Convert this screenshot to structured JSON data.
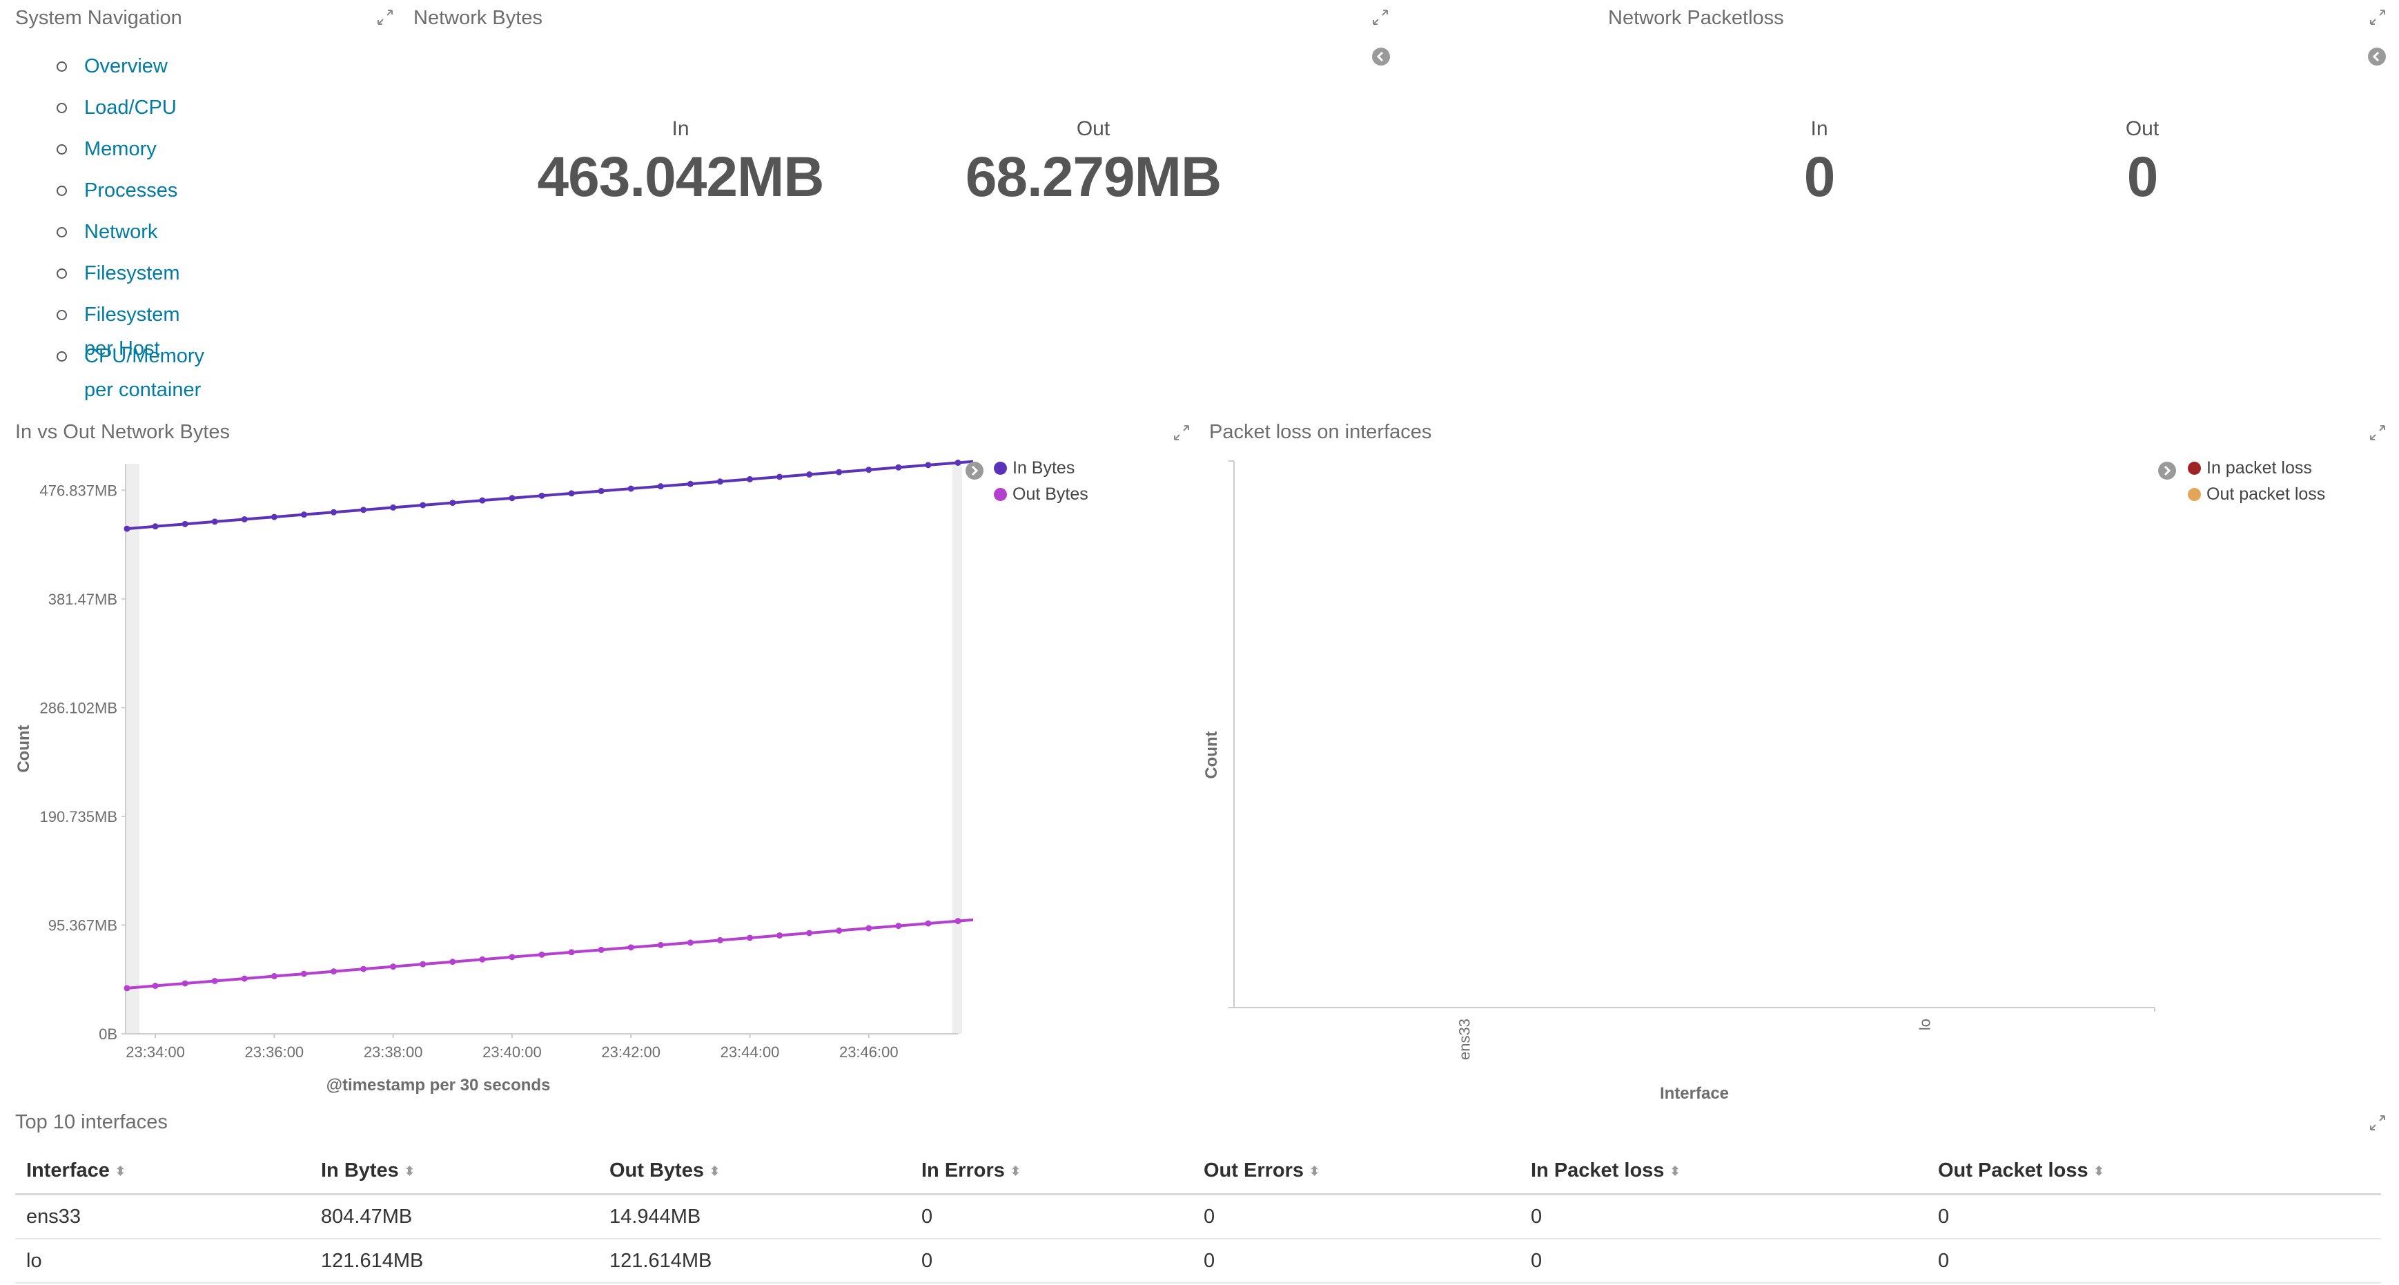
{
  "nav": {
    "title": "System Navigation",
    "items": [
      {
        "label": "Overview"
      },
      {
        "label": "Load/CPU"
      },
      {
        "label": "Memory"
      },
      {
        "label": "Processes"
      },
      {
        "label": "Network"
      },
      {
        "label": "Filesystem"
      },
      {
        "label": "Filesystem per Host"
      },
      {
        "label": "CPU/Memory per container"
      }
    ]
  },
  "network_bytes": {
    "title": "Network Bytes",
    "in_label": "In",
    "in_value": "463.042MB",
    "out_label": "Out",
    "out_value": "68.279MB"
  },
  "packetloss": {
    "title": "Network Packetloss",
    "in_label": "In",
    "in_value": "0",
    "out_label": "Out",
    "out_value": "0"
  },
  "bytes_chart_panel": {
    "title": "In vs Out Network Bytes",
    "legend": [
      {
        "label": "In Bytes",
        "color": "#5a33b8"
      },
      {
        "label": "Out Bytes",
        "color": "#b53fcf"
      }
    ]
  },
  "loss_chart_panel": {
    "title": "Packet loss on interfaces",
    "legend": [
      {
        "label": "In packet loss",
        "color": "#a12424"
      },
      {
        "label": "Out packet loss",
        "color": "#e3a658"
      }
    ]
  },
  "table": {
    "title": "Top 10 interfaces",
    "columns": [
      "Interface",
      "In Bytes",
      "Out Bytes",
      "In Errors",
      "Out Errors",
      "In Packet loss",
      "Out Packet loss"
    ],
    "rows": [
      [
        "ens33",
        "804.47MB",
        "14.944MB",
        "0",
        "0",
        "0",
        "0"
      ],
      [
        "lo",
        "121.614MB",
        "121.614MB",
        "0",
        "0",
        "0",
        "0"
      ]
    ]
  },
  "chart_data": [
    {
      "type": "line",
      "ylabel": "Count",
      "xlabel": "@timestamp per 30 seconds",
      "y_ticks": [
        "0B",
        "95.367MB",
        "190.735MB",
        "286.102MB",
        "381.47MB",
        "476.837MB"
      ],
      "ylim_mb": [
        0,
        500
      ],
      "x_ticks": [
        "23:34:00",
        "23:36:00",
        "23:38:00",
        "23:40:00",
        "23:42:00",
        "23:44:00",
        "23:46:00"
      ],
      "x_start": "23:33:30",
      "x_end": "23:47:30",
      "series": [
        {
          "name": "In Bytes",
          "color": "#5a33b8",
          "start_mb": 443,
          "end_mb": 503
        },
        {
          "name": "Out Bytes",
          "color": "#b53fcf",
          "start_mb": 40,
          "end_mb": 101
        }
      ]
    },
    {
      "type": "bar",
      "ylabel": "Count",
      "xlabel": "Interface",
      "categories": [
        "ens33",
        "lo"
      ],
      "series": [
        {
          "name": "In packet loss",
          "values": [
            0,
            0
          ]
        },
        {
          "name": "Out packet loss",
          "values": [
            0,
            0
          ]
        }
      ]
    }
  ]
}
